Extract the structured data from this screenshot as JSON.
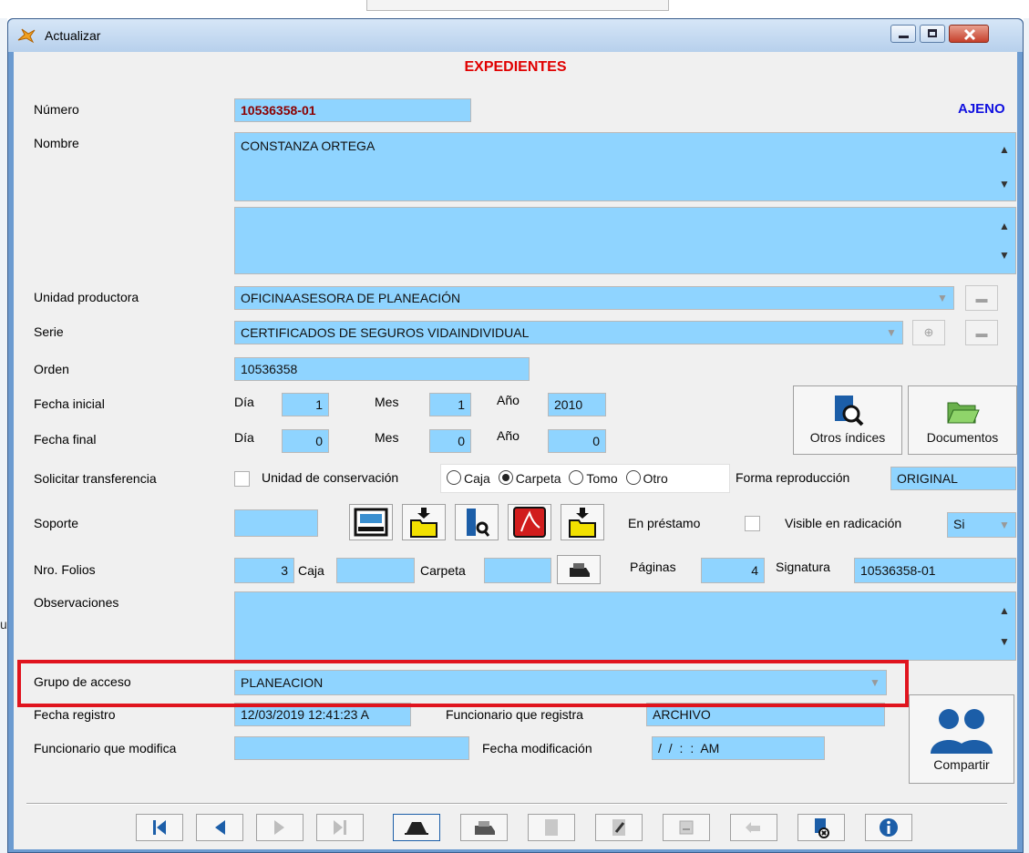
{
  "window": {
    "title": "Actualizar"
  },
  "form": {
    "heading": "EXPEDIENTES",
    "status": "AJENO",
    "labels": {
      "numero": "Número",
      "nombre": "Nombre",
      "unidad": "Unidad productora",
      "serie": "Serie",
      "orden": "Orden",
      "fecha_inicial": "Fecha inicial",
      "fecha_final": "Fecha final",
      "dia": "Día",
      "mes": "Mes",
      "anio": "Año",
      "solicitar": "Solicitar transferencia",
      "unidad_conservacion": "Unidad de conservación",
      "forma_reproduccion": "Forma reproducción",
      "soporte": "Soporte",
      "en_prestamo": "En préstamo",
      "visible": "Visible en radicación",
      "nro_folios": "Nro. Folios",
      "caja": "Caja",
      "carpeta": "Carpeta",
      "paginas": "Páginas",
      "signatura": "Signatura",
      "observaciones": "Observaciones",
      "grupo_acceso": "Grupo de acceso",
      "fecha_registro": "Fecha registro",
      "funcionario_registra": "Funcionario que registra",
      "funcionario_modifica": "Funcionario que modifica",
      "fecha_modificacion": "Fecha modificación"
    },
    "values": {
      "numero": "10536358-01",
      "nombre": "CONSTANZA ORTEGA",
      "unidad": "OFICINAASESORA DE PLANEACIÓN",
      "serie": "CERTIFICADOS DE SEGUROS VIDAINDIVIDUAL",
      "orden": "10536358",
      "fi_dia": "1",
      "fi_mes": "1",
      "fi_anio": "2010",
      "ff_dia": "0",
      "ff_mes": "0",
      "ff_anio": "0",
      "forma_reproduccion": "ORIGINAL",
      "visible": "Si",
      "folios": "3",
      "paginas": "4",
      "signatura": "10536358-01",
      "grupo_acceso": "PLANEACION",
      "fecha_registro": "12/03/2019 12:41:23 A",
      "funcionario_registra": "ARCHIVO",
      "fecha_modificacion": "/ /      : :  AM"
    },
    "radios": [
      {
        "label": "Caja",
        "checked": false
      },
      {
        "label": "Carpeta",
        "checked": true
      },
      {
        "label": "Tomo",
        "checked": false
      },
      {
        "label": "Otro",
        "checked": false
      }
    ],
    "buttons": {
      "otros_indices": "Otros índices",
      "documentos": "Documentos",
      "compartir": "Compartir"
    }
  },
  "colors": {
    "field_bg": "#8fd4ff",
    "heading": "#e00000",
    "status": "#1010e0",
    "number_text": "#8b0000",
    "highlight_box": "#e0141e"
  },
  "icons": {
    "toolbar": [
      "scanner-icon",
      "folder-import-icon",
      "document-search-icon",
      "pdf-icon",
      "folder-export-icon",
      "printer-icon"
    ],
    "navigation": [
      "first-record-icon",
      "previous-record-icon",
      "next-record-icon",
      "last-record-icon",
      "view-icon",
      "print-icon",
      "new-record-icon",
      "edit-record-icon",
      "save-icon",
      "undo-icon",
      "delete-icon",
      "info-icon"
    ]
  }
}
